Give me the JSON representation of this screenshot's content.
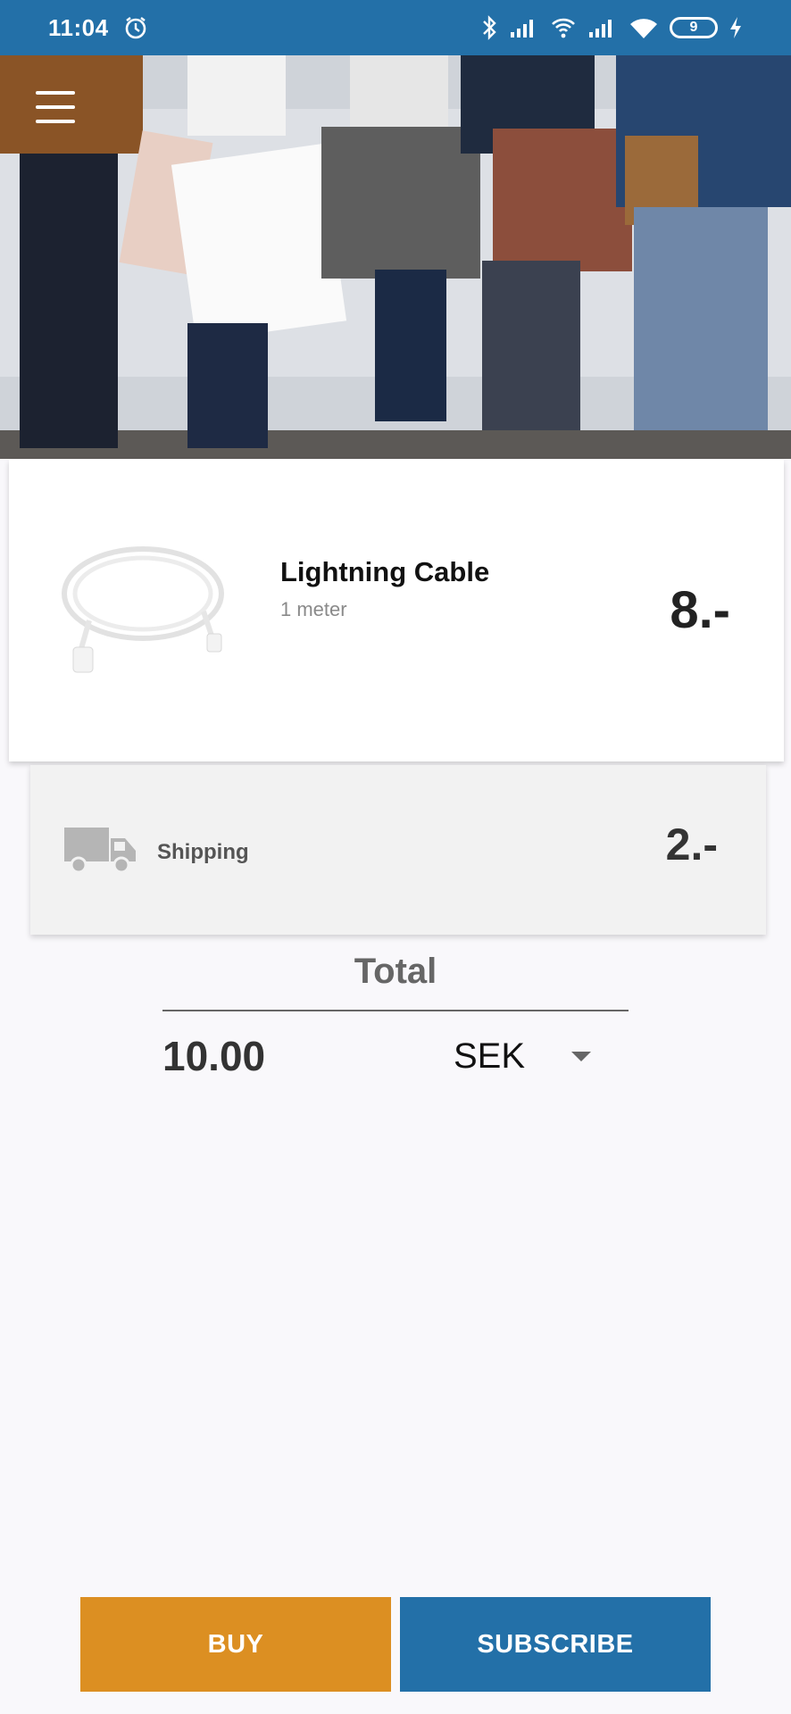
{
  "status_bar": {
    "time": "11:04",
    "battery": "9",
    "icons": [
      "alarm-icon",
      "bluetooth-icon",
      "signal-icon",
      "wifi-calling-icon",
      "signal-icon",
      "wifi-icon",
      "battery-icon",
      "charging-icon"
    ]
  },
  "hero": {
    "image": "shoppers-with-bags-photo",
    "menu_icon": "hamburger-menu-icon"
  },
  "product": {
    "name": "Lightning Cable",
    "subtitle": "1 meter",
    "price": "8.-",
    "image": "lightning-cable-photo"
  },
  "shipping": {
    "label": "Shipping",
    "price": "2.-",
    "icon": "truck-icon"
  },
  "total": {
    "title": "Total",
    "value": "10.00",
    "currency": "SEK"
  },
  "buttons": {
    "buy": "BUY",
    "subscribe": "SUBSCRIBE"
  },
  "colors": {
    "status_bar": "#2370a8",
    "buy": "#dc8f22",
    "subscribe": "#2370a8",
    "background": "#f9f8fb"
  }
}
